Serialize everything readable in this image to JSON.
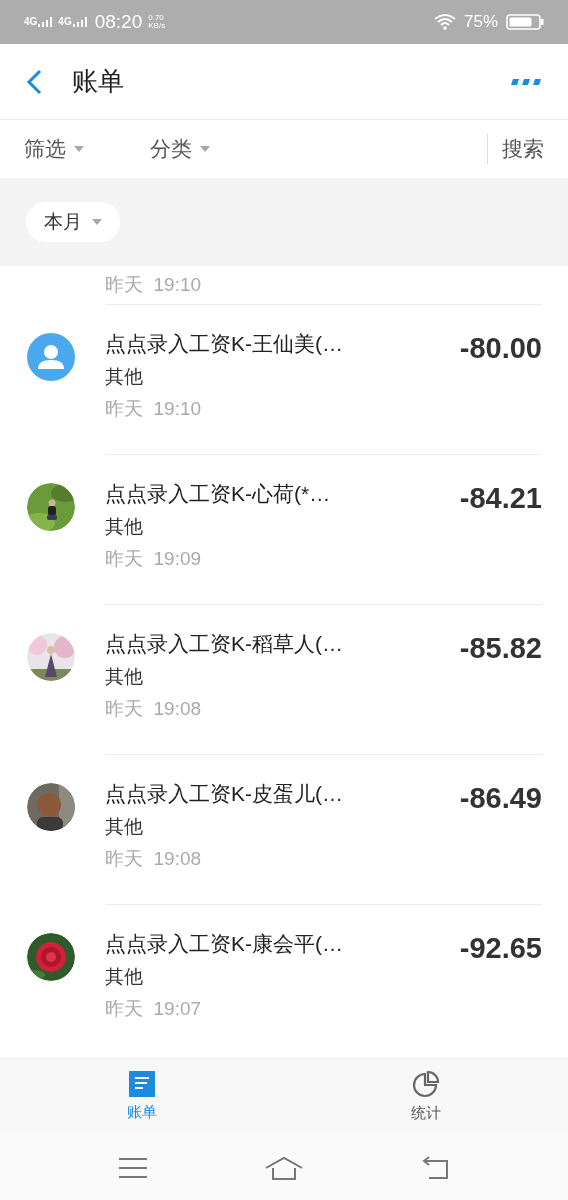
{
  "status_bar": {
    "network_1": "4G",
    "network_2": "4G",
    "time": "08:20",
    "speed_value": "0.70",
    "speed_unit": "KB/s",
    "battery": "75%"
  },
  "header": {
    "title": "账单"
  },
  "filter_bar": {
    "filters": [
      {
        "label": "筛选"
      },
      {
        "label": "分类"
      }
    ],
    "search": "搜索"
  },
  "period": {
    "label": "本月"
  },
  "partial_time": "昨天  19:10",
  "transactions": [
    {
      "avatar": {
        "kind": "user"
      },
      "title": "点点录入工资K-王仙美(…",
      "category": "其他",
      "time": "昨天  19:10",
      "amount": "-80.00"
    },
    {
      "title": "点点录入工资K-心荷(*…",
      "category": "其他",
      "time": "昨天  19:09",
      "amount": "-84.21"
    },
    {
      "title": "点点录入工资K-稻草人(…",
      "category": "其他",
      "time": "昨天  19:08",
      "amount": "-85.82"
    },
    {
      "title": "点点录入工资K-皮蛋儿(…",
      "category": "其他",
      "time": "昨天  19:08",
      "amount": "-86.49"
    },
    {
      "title": "点点录入工资K-康会平(…",
      "category": "其他",
      "time": "昨天  19:07",
      "amount": "-92.65"
    }
  ],
  "tab_bar": [
    {
      "kind": "bill",
      "label": "账单",
      "selected": true
    },
    {
      "kind": "stats",
      "label": "统计",
      "selected": false
    }
  ]
}
